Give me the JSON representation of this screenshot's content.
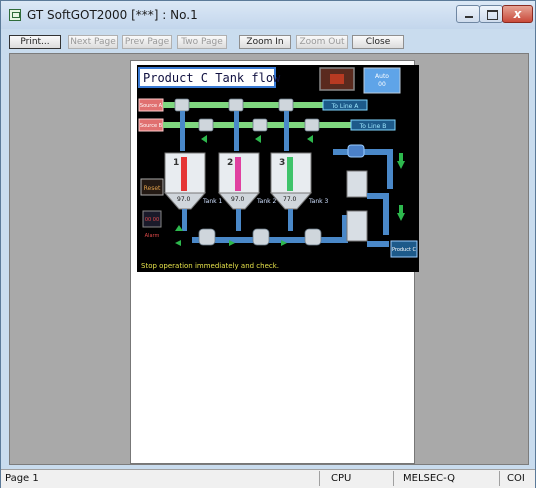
{
  "window": {
    "title": "GT SoftGOT2000  [***]  :  No.1",
    "close_glyph": "x"
  },
  "toolbar": {
    "print": "Print...",
    "next_page": "Next Page",
    "prev_page": "Prev Page",
    "two_page": "Two Page",
    "zoom_in": "Zoom In",
    "zoom_out": "Zoom Out",
    "close": "Close"
  },
  "hmi": {
    "title": "Product C Tank flow",
    "auto_label": "Auto",
    "auto_value": "00",
    "source_a": "Source A",
    "source_b": "Source B",
    "to_line_a": "To Line A",
    "to_line_b": "To Line B",
    "tank1_name": "Tank 1",
    "tank1_value": "97.0",
    "tank2_name": "Tank 2",
    "tank2_value": "97.0",
    "tank3_name": "Tank 3",
    "tank3_value": "77.0",
    "tank_numbers": [
      "1",
      "2",
      "3"
    ],
    "reset": "Reset",
    "alarm": "Alarm",
    "alarm_value": "00 00",
    "product": "Product C",
    "message": "Stop operation immediately and check."
  },
  "statusbar": {
    "page": "Page 1",
    "cpu": "CPU",
    "plc": "MELSEC-Q",
    "com": "COI"
  },
  "colors": {
    "pipe": "#5aa0d8",
    "arrow": "#2db84d",
    "tank_red": "#e53535",
    "tank_pink": "#e040a0",
    "tank_green": "#3fc36a"
  }
}
